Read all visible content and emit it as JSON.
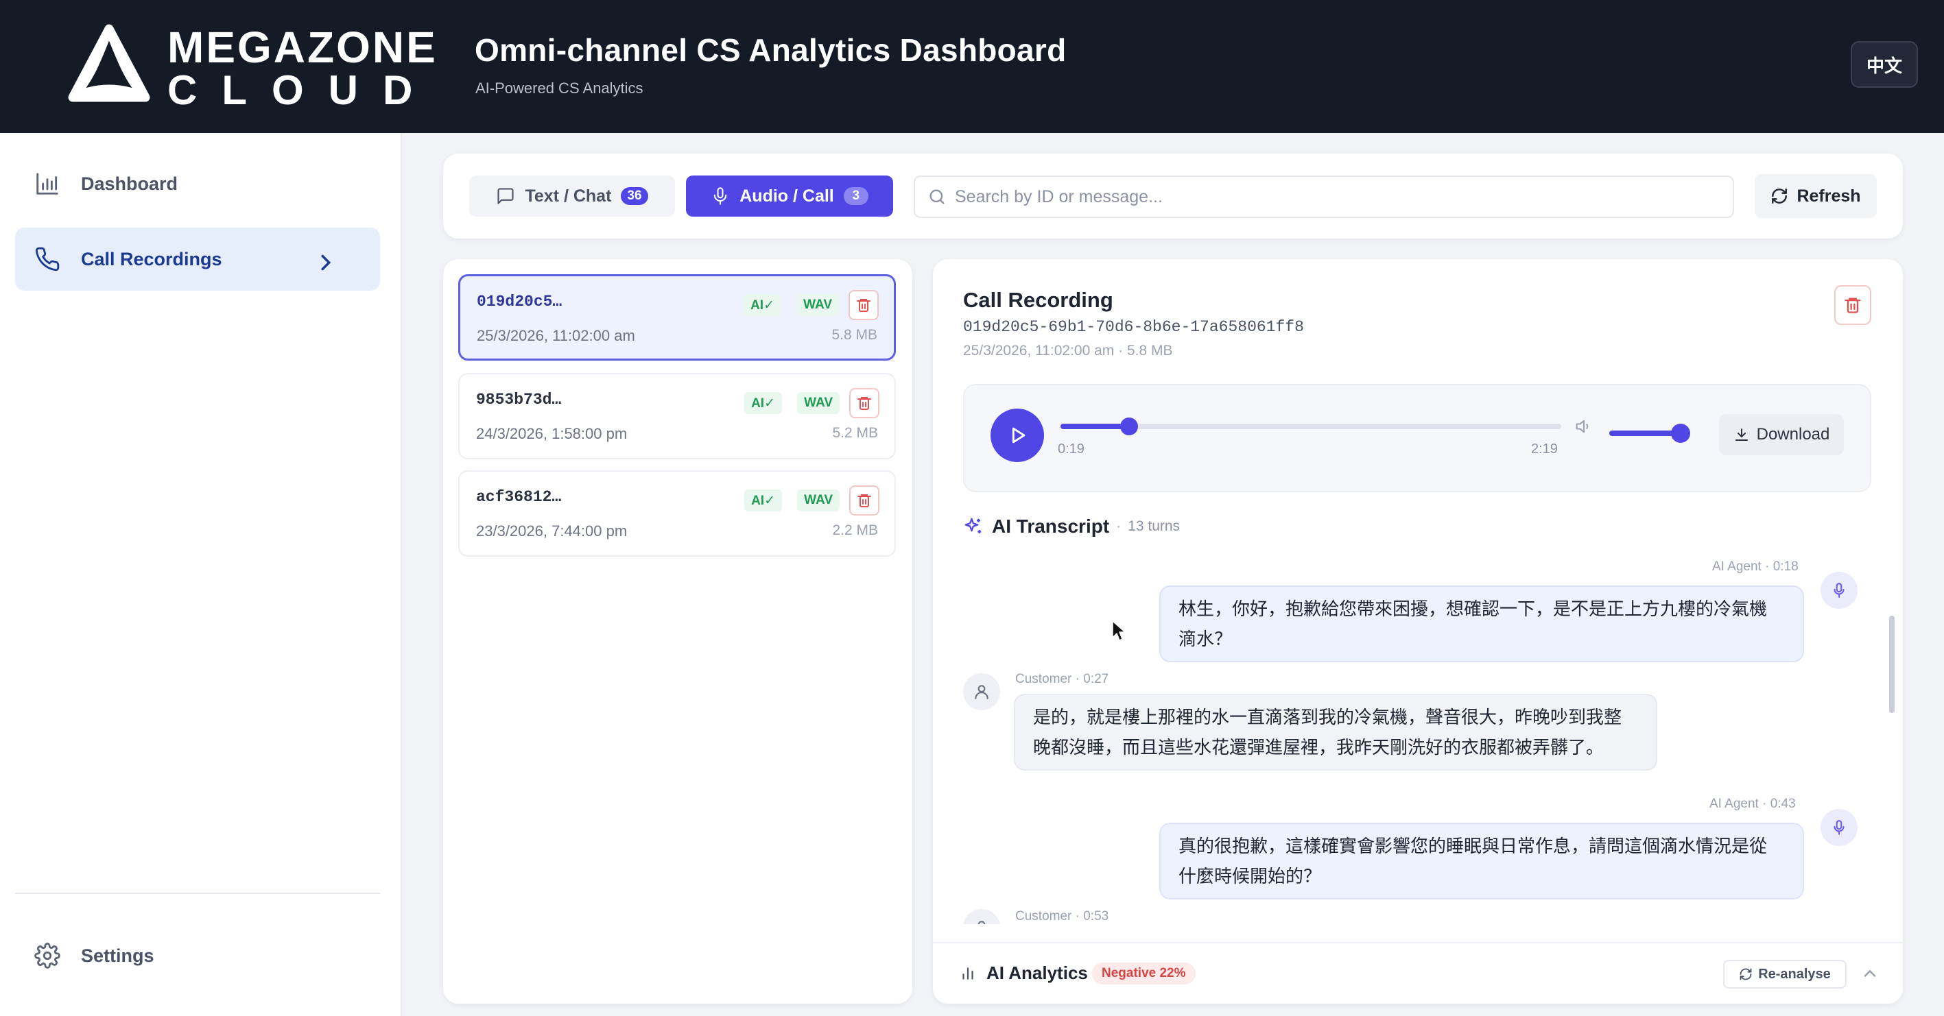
{
  "header": {
    "logo_line1": "MEGAZONE",
    "logo_line2": "CLOUD",
    "title": "Omni-channel CS Analytics Dashboard",
    "subtitle": "AI-Powered CS Analytics",
    "language_button": "中文"
  },
  "sidebar": {
    "items": [
      {
        "label": "Dashboard",
        "icon": "bar-chart-icon",
        "active": false
      },
      {
        "label": "Call Recordings",
        "icon": "phone-icon",
        "active": true
      }
    ],
    "settings_label": "Settings"
  },
  "toolbar": {
    "tabs": [
      {
        "label": "Text / Chat",
        "count": "36",
        "icon": "chat-icon",
        "active": false
      },
      {
        "label": "Audio / Call",
        "count": "3",
        "icon": "microphone-icon",
        "active": true
      }
    ],
    "search_placeholder": "Search by ID or message...",
    "refresh_label": "Refresh"
  },
  "recordings": [
    {
      "id": "019d20c5…",
      "date": "25/3/2026, 11:02:00 am",
      "size": "5.8 MB",
      "ai_badge": "AI✓",
      "format_badge": "WAV",
      "selected": true
    },
    {
      "id": "9853b73d…",
      "date": "24/3/2026, 1:58:00 pm",
      "size": "5.2 MB",
      "ai_badge": "AI✓",
      "format_badge": "WAV",
      "selected": false
    },
    {
      "id": "acf36812…",
      "date": "23/3/2026, 7:44:00 pm",
      "size": "2.2 MB",
      "ai_badge": "AI✓",
      "format_badge": "WAV",
      "selected": false
    }
  ],
  "detail": {
    "title": "Call Recording",
    "uuid": "019d20c5-69b1-70d6-8b6e-17a658061ff8",
    "meta": "25/3/2026, 11:02:00 am · 5.8 MB",
    "player": {
      "current_time": "0:19",
      "duration": "2:19",
      "progress": 0.137,
      "volume": 0.88,
      "download_label": "Download"
    },
    "transcript_title": "AI Transcript",
    "transcript_separator": "·",
    "transcript_turns": "13 turns",
    "messages": [
      {
        "speaker": "agent",
        "meta": "AI Agent · 0:18",
        "text1": "林生，你好，抱歉給您帶來困擾，想確認一下，是不是正上方九樓的冷氣機",
        "text2": "滴水？"
      },
      {
        "speaker": "customer",
        "meta": "Customer · 0:27",
        "text1": "是的，就是樓上那裡的水一直滴落到我的冷氣機，聲音很大，昨晚吵到我整",
        "text2": "晚都沒睡，而且這些水花還彈進屋裡，我昨天剛洗好的衣服都被弄髒了。"
      },
      {
        "speaker": "agent",
        "meta": "AI Agent · 0:43",
        "text1": "真的很抱歉，這樣確實會影響您的睡眠與日常作息，請問這個滴水情況是從",
        "text2": "什麼時候開始的？"
      },
      {
        "speaker": "customer",
        "meta": "Customer · 0:53",
        "text1": "",
        "text2": ""
      }
    ],
    "analytics": {
      "title": "AI Analytics",
      "sentiment_badge": "Negative 22%",
      "reanalyse_label": "Re-analyse"
    }
  },
  "colors": {
    "accent": "#4f46e5",
    "header_bg": "#151a27",
    "success": "#1f9a52",
    "danger": "#d64545"
  }
}
